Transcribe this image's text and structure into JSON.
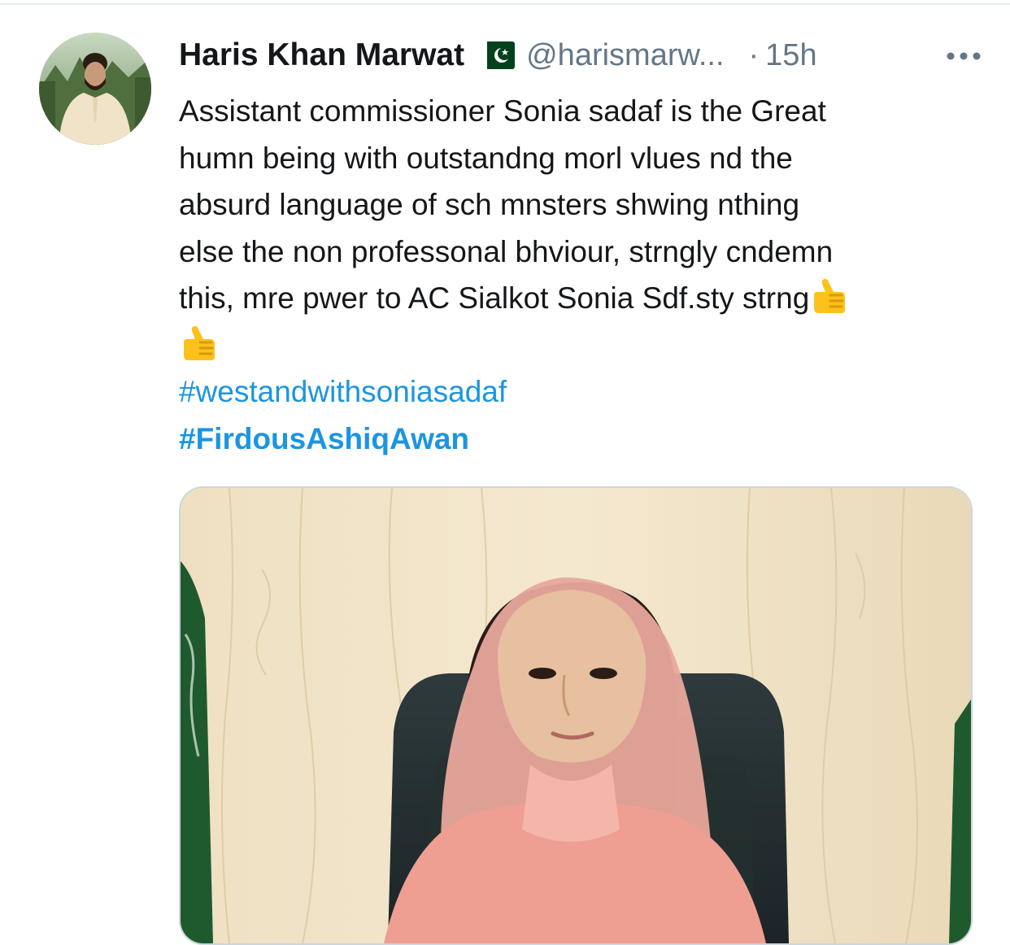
{
  "tweet": {
    "author": {
      "display_name": "Haris Khan Marwat",
      "handle": "@harismarw...",
      "flag_icon": "pakistan-flag-icon"
    },
    "separator": "·",
    "timestamp": "15h",
    "more_icon": "more-options-icon",
    "text_lines": [
      "Assistant commissioner Sonia sadaf is the Great",
      "humn being with outstandng morl vlues nd the",
      "absurd language of sch mnsters shwing nthing",
      "else the non professonal bhviour, strngly cndemn",
      "this, mre pwer to AC Sialkot Sonia Sdf.sty strng"
    ],
    "emoji": "thumbs-up-icon",
    "hashtags": [
      "#westandwithsoniasadaf",
      "#FirdousAshiqAwan"
    ],
    "media": {
      "type": "photo"
    }
  },
  "colors": {
    "link": "#1b95e0",
    "secondary_text": "#657786",
    "primary_text": "#14171a",
    "border": "#ccd6dd"
  }
}
